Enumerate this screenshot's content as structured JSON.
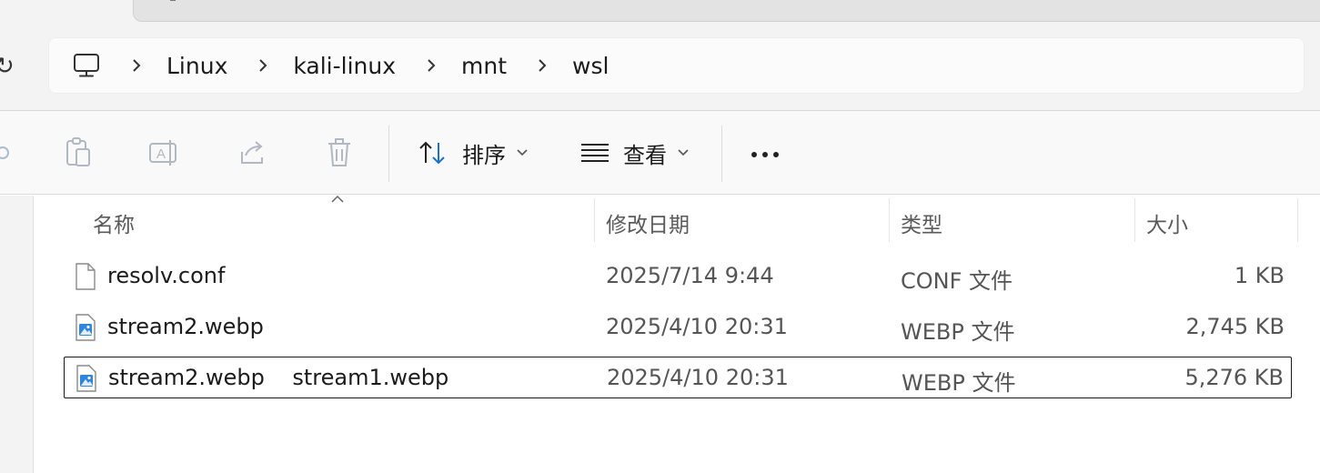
{
  "breadcrumb": {
    "items": [
      "Linux",
      "kali-linux",
      "mnt",
      "wsl"
    ]
  },
  "toolbar": {
    "sort_label": "排序",
    "view_label": "查看"
  },
  "columns": {
    "name": "名称",
    "date": "修改日期",
    "type": "类型",
    "size": "大小"
  },
  "files": [
    {
      "name": "resolv.conf",
      "date": "2025/7/14 9:44",
      "type": "CONF 文件",
      "size": "1 KB",
      "icon": "file-icon"
    },
    {
      "name": "stream2.webp",
      "date": "2025/4/10 20:31",
      "type": "WEBP 文件",
      "size": "2,745 KB",
      "icon": "image-file-icon"
    },
    {
      "name": "stream2.webp    stream1.webp",
      "date": "2025/4/10 20:31",
      "type": "WEBP 文件",
      "size": "5,276 KB",
      "icon": "image-file-icon"
    }
  ],
  "colors": {
    "accent": "#1a6fd0",
    "text_muted": "#555555"
  }
}
